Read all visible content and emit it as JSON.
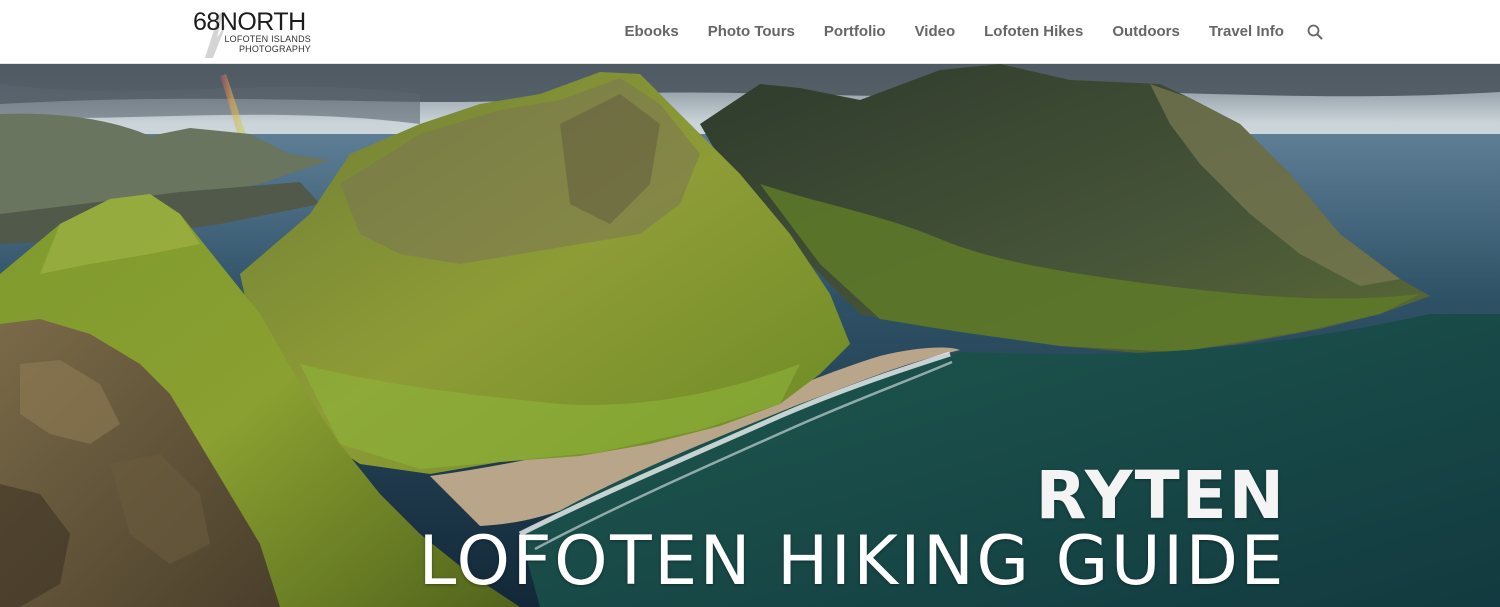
{
  "header": {
    "logo": {
      "title": "68NORTH",
      "subtitle_line1": "LOFOTEN ISLANDS",
      "subtitle_line2": "PHOTOGRAPHY"
    },
    "nav": [
      {
        "label": "Ebooks"
      },
      {
        "label": "Photo Tours"
      },
      {
        "label": "Portfolio"
      },
      {
        "label": "Video"
      },
      {
        "label": "Lofoten Hikes"
      },
      {
        "label": "Outdoors"
      },
      {
        "label": "Travel Info"
      }
    ],
    "search_icon": "search-icon"
  },
  "hero": {
    "image": "aerial view of green mountains, sandy beach bay and sea with rainbow",
    "title": "RYTEN",
    "subtitle": "LOFOTEN HIKING GUIDE"
  },
  "colors": {
    "nav_text": "#666666",
    "header_bg": "#ffffff",
    "hero_text": "#ffffff"
  }
}
